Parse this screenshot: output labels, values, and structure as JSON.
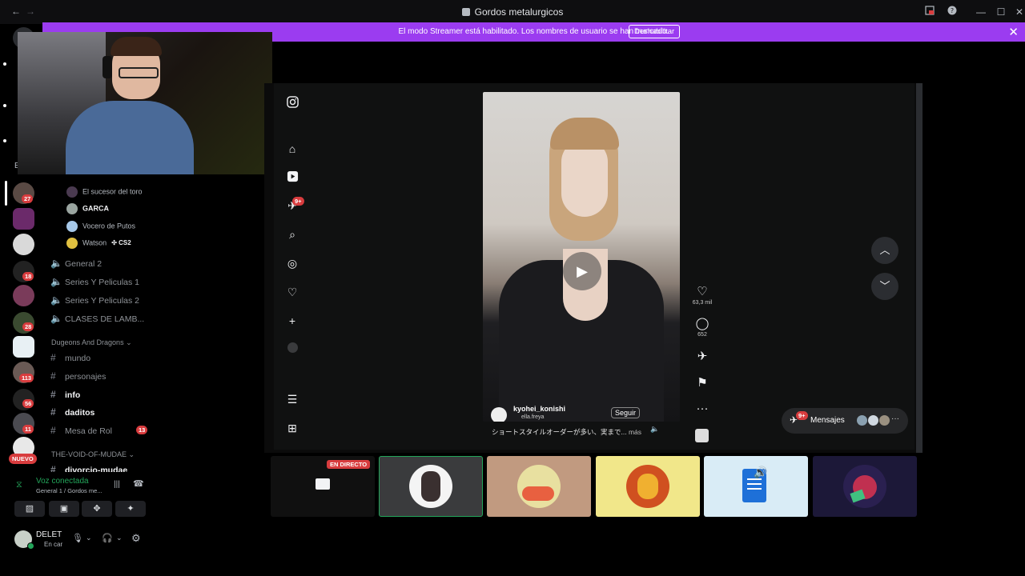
{
  "window": {
    "title": "Gordos metalurgicos",
    "back": "←",
    "forward": "→"
  },
  "banner": {
    "text": "El modo Streamer está habilitado. Los nombres de usuario se han truncado.",
    "button": "Deshabilitar",
    "close": "✕"
  },
  "servers": [
    {
      "badge": "27"
    },
    {
      "badge": ""
    },
    {
      "badge": ""
    },
    {
      "badge": "18"
    },
    {
      "badge": ""
    },
    {
      "badge": "28"
    },
    {
      "badge": ""
    },
    {
      "badge": "113"
    },
    {
      "badge": "56"
    },
    {
      "badge": "11"
    }
  ],
  "rail_letter": "E",
  "new_badge": "NUEVO",
  "voice_users": [
    {
      "name": "El sucesor del toro"
    },
    {
      "name": "GARCA"
    },
    {
      "name": "Vocero de Putos"
    },
    {
      "name": "Watson",
      "tag": "CS2"
    }
  ],
  "voice_channels": [
    "General 2",
    "Series Y Peliculas 1",
    "Series Y Peliculas 2",
    "CLASES DE LAMB..."
  ],
  "category1": "Dugeons And Dragons",
  "text_channels": [
    {
      "name": "mundo",
      "badge": ""
    },
    {
      "name": "personajes",
      "badge": ""
    },
    {
      "name": "info",
      "badge": ""
    },
    {
      "name": "daditos",
      "badge": ""
    },
    {
      "name": "Mesa de Rol",
      "badge": "13"
    }
  ],
  "category2": "THE-VOID-OF-MUDAE",
  "partial_channel": "divorcio-mudae",
  "voice_status": {
    "title": "Voz conectada",
    "subtitle": "General 1 / Gordos me..."
  },
  "user": {
    "name": "DELET",
    "status": "En car"
  },
  "instagram": {
    "messages_badge": "9+",
    "likes": "63,3 mil",
    "comments": "652",
    "username": "kyohei_konishi",
    "sub": "ella.freya",
    "follow": "Seguir",
    "caption": "ショートスタイルオーダーが多い、実まで...",
    "more": "más",
    "messages_label": "Mensajes",
    "messages_pill_badge": "9+",
    "more_dots": "···"
  },
  "tiles": {
    "live_label": "EN DIRECTO"
  },
  "colors": {
    "banner": "#9b3cf0",
    "badge": "#d83c3e",
    "voice_green": "#23a55a"
  }
}
